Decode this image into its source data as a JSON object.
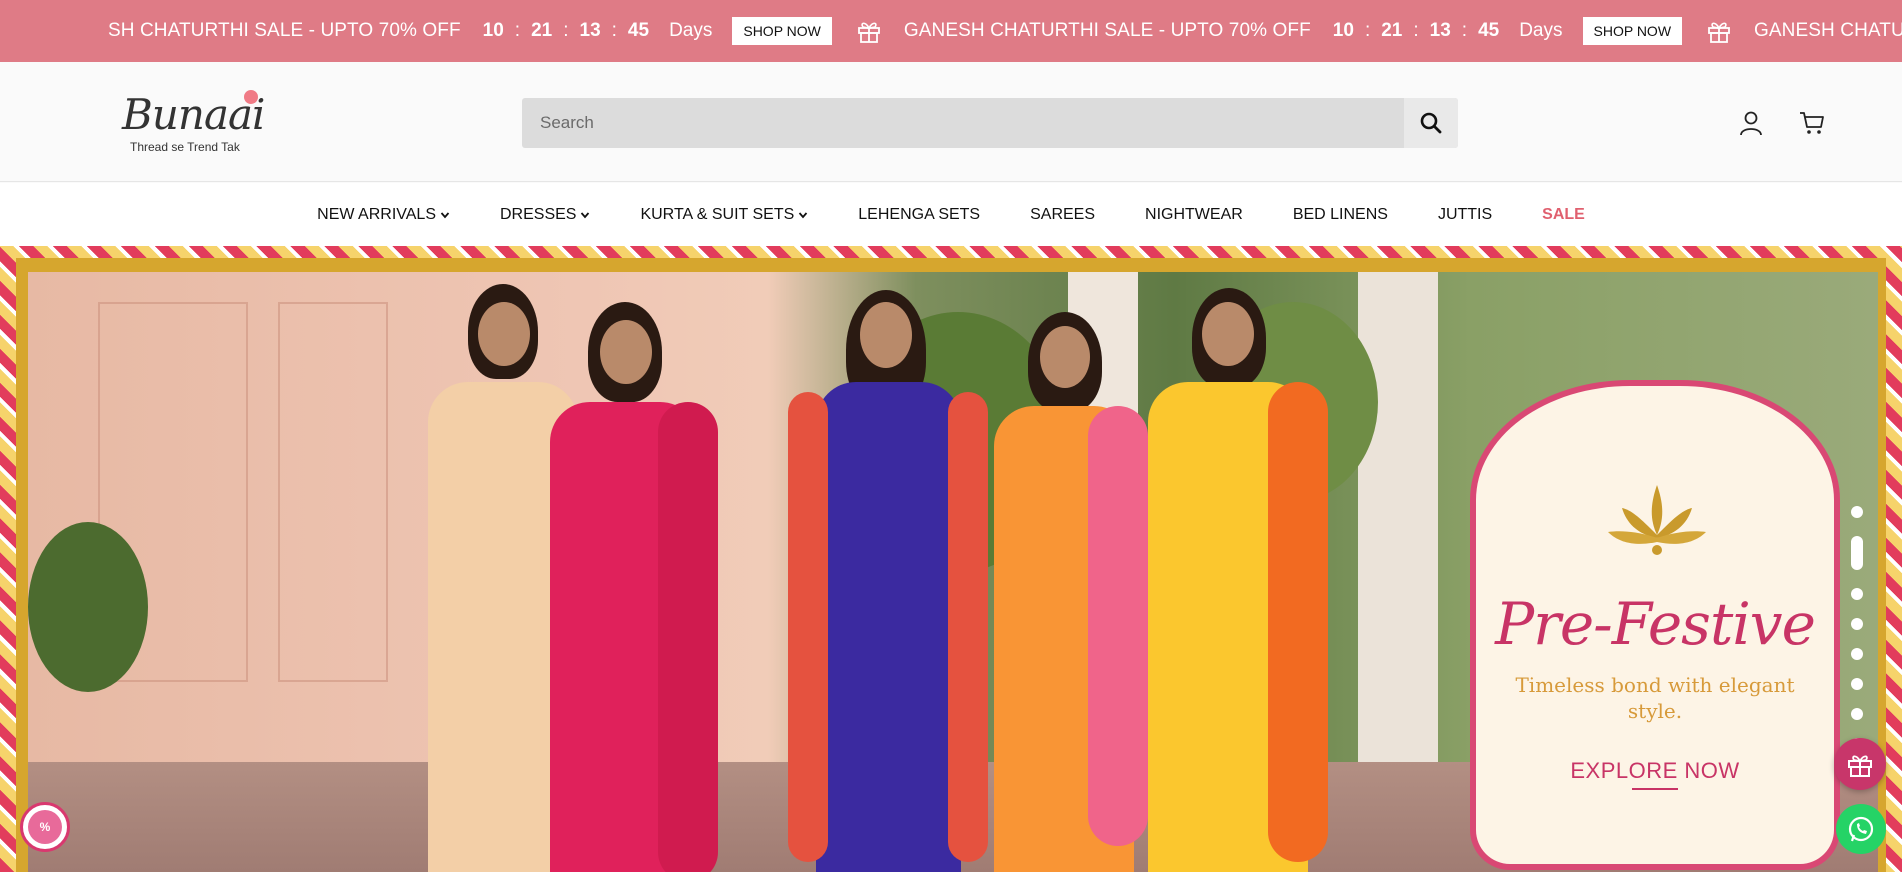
{
  "announcement": {
    "items": [
      {
        "text": "SH CHATURTHI SALE - UPTO 70% OFF",
        "timer": [
          "10",
          "21",
          "13",
          "45"
        ],
        "days_label": "Days",
        "button": "SHOP NOW"
      },
      {
        "text": "GANESH CHATURTHI SALE - UPTO 70% OFF",
        "timer": [
          "10",
          "21",
          "13",
          "45"
        ],
        "days_label": "Days",
        "button": "SHOP NOW"
      },
      {
        "text": "GANESH CHATURTHI S",
        "timer": [],
        "days_label": "",
        "button": ""
      }
    ],
    "separator": ":"
  },
  "header": {
    "logo_word": "Bunaai",
    "logo_tagline": "Thread se Trend Tak",
    "search_placeholder": "Search"
  },
  "nav": {
    "items": [
      {
        "label": "NEW ARRIVALS",
        "dropdown": true
      },
      {
        "label": "DRESSES",
        "dropdown": true
      },
      {
        "label": "KURTA & SUIT SETS",
        "dropdown": true
      },
      {
        "label": "LEHENGA SETS",
        "dropdown": false
      },
      {
        "label": "SAREES",
        "dropdown": false
      },
      {
        "label": "NIGHTWEAR",
        "dropdown": false
      },
      {
        "label": "BED LINENS",
        "dropdown": false
      },
      {
        "label": "JUTTIS",
        "dropdown": false
      },
      {
        "label": "SALE",
        "dropdown": false
      }
    ]
  },
  "hero": {
    "title": "Pre-Festive",
    "subtitle": "Timeless bond with elegant style.",
    "cta": "EXPLORE NOW",
    "slides_total": 8,
    "active_slide": 2
  },
  "discount_badge": "%",
  "colors": {
    "announce_bg": "#df7b86",
    "accent": "#c83466",
    "sale": "#e0606f",
    "whatsapp": "#25d366"
  }
}
